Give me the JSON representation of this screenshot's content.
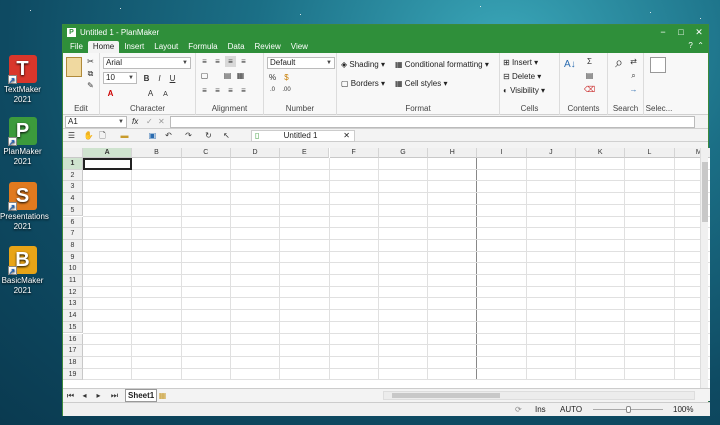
{
  "desktop": {
    "icons": [
      {
        "label": "TextMaker 2021",
        "letter": "T",
        "color": "#d9362b"
      },
      {
        "label": "PlanMaker 2021",
        "letter": "P",
        "color": "#3c9a3c"
      },
      {
        "label": "Presentations 2021",
        "letter": "S",
        "color": "#e07a1f"
      },
      {
        "label": "BasicMaker 2021",
        "letter": "B",
        "color": "#e8a417"
      }
    ]
  },
  "window": {
    "title": "Untitled 1 - PlanMaker",
    "controls": {
      "minimize": "−",
      "maximize": "□",
      "close": "✕"
    }
  },
  "menu": {
    "tabs": [
      "File",
      "Home",
      "Insert",
      "Layout",
      "Formula",
      "Data",
      "Review",
      "View"
    ],
    "active": "Home",
    "help": "?",
    "collapse": "⌃"
  },
  "ribbon": {
    "font_name": "Arial",
    "font_size": "10",
    "number_format": "Default",
    "shading": "Shading",
    "conditional_formatting": "Conditional formatting",
    "borders": "Borders",
    "cell_styles": "Cell styles",
    "insert": "Insert",
    "delete": "Delete",
    "visibility": "Visibility",
    "groups": [
      "Edit",
      "Character",
      "Alignment",
      "Number",
      "Format",
      "Cells",
      "Contents",
      "Search",
      "Selec..."
    ]
  },
  "formula_bar": {
    "cell_ref": "A1",
    "fx": "fx"
  },
  "doc_tab": {
    "title": "Untitled 1"
  },
  "grid": {
    "columns": [
      "A",
      "B",
      "C",
      "D",
      "E",
      "F",
      "G",
      "H",
      "I",
      "J",
      "K",
      "L",
      "M"
    ],
    "rows": [
      "1",
      "2",
      "3",
      "4",
      "5",
      "6",
      "7",
      "8",
      "9",
      "10",
      "11",
      "12",
      "13",
      "14",
      "15",
      "16",
      "17",
      "18",
      "19"
    ],
    "active_cell": "A1"
  },
  "sheets": {
    "tabs": [
      "Sheet1"
    ]
  },
  "status": {
    "mode": "Ins",
    "calc": "AUTO",
    "zoom": "100%"
  },
  "colors": {
    "accent": "#2f8f3a"
  }
}
